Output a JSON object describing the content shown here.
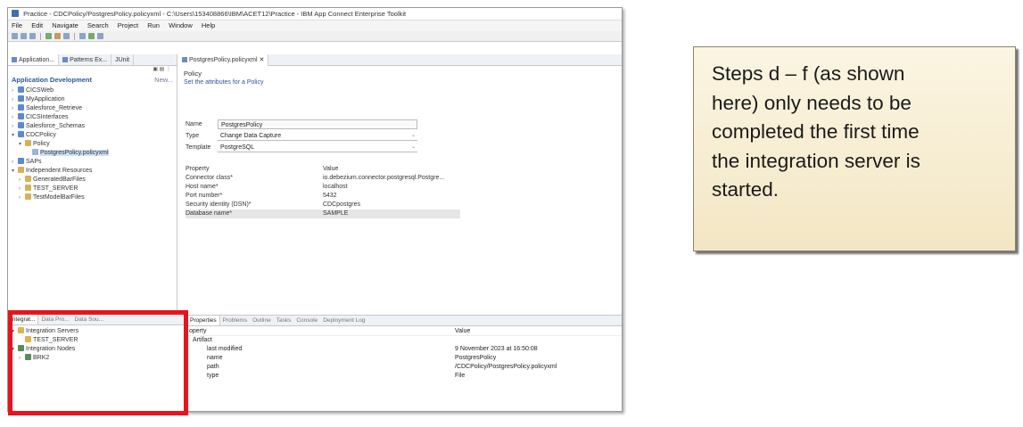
{
  "window": {
    "title": "Practice - CDCPolicy/PostgresPolicy.policyxml - C:\\Users\\153408866\\IBM\\ACET12\\Practice - IBM App Connect Enterprise Toolkit"
  },
  "menubar": [
    "File",
    "Edit",
    "Navigate",
    "Search",
    "Project",
    "Run",
    "Window",
    "Help"
  ],
  "left_pane": {
    "tabs": [
      "Application...",
      "Patterns Ex...",
      "JUnit"
    ],
    "section_title": "Application Development",
    "section_sub": "New...",
    "tree": [
      {
        "label": "CICSWeb",
        "indent": 0,
        "twisty": "›",
        "icon": "proj"
      },
      {
        "label": "MyApplication",
        "indent": 0,
        "twisty": "›",
        "icon": "proj"
      },
      {
        "label": "Salesforce_Retrieve",
        "indent": 0,
        "twisty": "›",
        "icon": "proj"
      },
      {
        "label": "CICSInterfaces",
        "indent": 0,
        "twisty": "›",
        "icon": "proj"
      },
      {
        "label": "Salesforce_Schemas",
        "indent": 0,
        "twisty": "›",
        "icon": "proj"
      },
      {
        "label": "CDCPolicy",
        "indent": 0,
        "twisty": "▾",
        "icon": "proj"
      },
      {
        "label": "Policy",
        "indent": 1,
        "twisty": "▾",
        "icon": "folder"
      },
      {
        "label": "PostgresPolicy.policyxml",
        "indent": 2,
        "twisty": "",
        "icon": "file",
        "selected": true
      },
      {
        "label": "SAPs",
        "indent": 0,
        "twisty": "›",
        "icon": "proj"
      },
      {
        "label": "Independent Resources",
        "indent": 0,
        "twisty": "▾",
        "icon": "folder"
      },
      {
        "label": "GeneratedBarFiles",
        "indent": 1,
        "twisty": "›",
        "icon": "folder"
      },
      {
        "label": "TEST_SERVER",
        "indent": 1,
        "twisty": "›",
        "icon": "folder"
      },
      {
        "label": "TestModelBarFiles",
        "indent": 1,
        "twisty": "›",
        "icon": "folder"
      }
    ]
  },
  "editor": {
    "tab": "PostgresPolicy.policyxml",
    "title": "Policy",
    "description": "Set the attributes for a Policy",
    "name_label": "Name",
    "name_value": "PostgresPolicy",
    "type_label": "Type",
    "type_value": "Change Data Capture",
    "template_label": "Template",
    "template_value": "PostgreSQL",
    "props_header": [
      "Property",
      "Value"
    ],
    "props": [
      {
        "key": "Connector class*",
        "value": "io.debezium.connector.postgresql.Postgre..."
      },
      {
        "key": "Host name*",
        "value": "localhost"
      },
      {
        "key": "Port number*",
        "value": "5432"
      },
      {
        "key": "Security identity (DSN)*",
        "value": "CDCpostgres"
      },
      {
        "key": "Database name*",
        "value": "SAMPLE",
        "highlight": true
      }
    ]
  },
  "bottom_left": {
    "tabs": [
      "Integrat...",
      "Data Pro...",
      "Data Sou..."
    ],
    "tree": [
      {
        "label": "Integration Servers",
        "indent": 0,
        "twisty": "▾",
        "icon": "server"
      },
      {
        "label": "TEST_SERVER",
        "indent": 1,
        "twisty": "",
        "icon": "server"
      },
      {
        "label": "Integration Nodes",
        "indent": 0,
        "twisty": "▾",
        "icon": "node"
      },
      {
        "label": "BRK2",
        "indent": 1,
        "twisty": "›",
        "icon": "node"
      }
    ]
  },
  "bottom_right": {
    "tabs": [
      "Properties",
      "Problems",
      "Outline",
      "Tasks",
      "Console",
      "Deployment Log"
    ],
    "header": [
      "operty",
      "Value"
    ],
    "rows": [
      {
        "key": "Artifact",
        "value": "",
        "level": 1
      },
      {
        "key": "last modified",
        "value": "9 November 2023 at 16:50:08",
        "level": 2
      },
      {
        "key": "name",
        "value": "PostgresPolicy",
        "level": 2
      },
      {
        "key": "path",
        "value": "/CDCPolicy/PostgresPolicy.policyxml",
        "level": 2
      },
      {
        "key": "type",
        "value": "File",
        "level": 2
      }
    ]
  },
  "callout": {
    "text": "Steps d – f (as shown\nhere) only needs to be\ncompleted the first time\nthe integration server is\nstarted."
  },
  "colors": {
    "highlight_border": "#e8141c",
    "callout_bg": "#f7eed3",
    "section_title": "#2b5797"
  }
}
